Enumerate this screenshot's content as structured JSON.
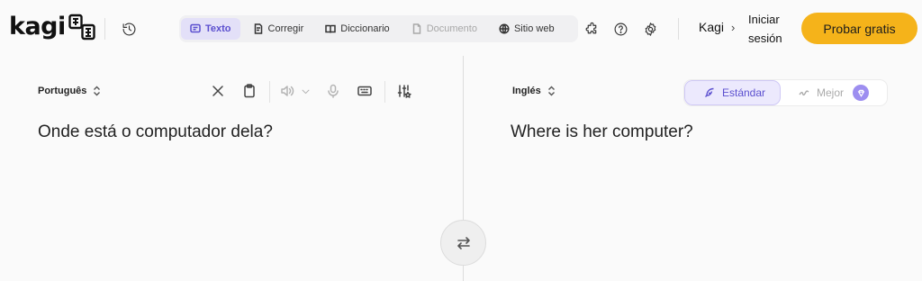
{
  "app": {
    "logo_text": "kagi",
    "logo_glyph": "translate-glyph-icon"
  },
  "header": {
    "history_icon": "history-icon",
    "tabs": [
      {
        "label": "Texto",
        "icon": "text-chat-icon",
        "active": true
      },
      {
        "label": "Corregir",
        "icon": "proofread-icon",
        "active": false
      },
      {
        "label": "Diccionario",
        "icon": "book-icon",
        "active": false
      },
      {
        "label": "Documento",
        "icon": "document-icon",
        "active": false,
        "disabled": true
      },
      {
        "label": "Sitio web",
        "icon": "globe-icon",
        "active": false
      }
    ],
    "extension_icon": "puzzle-icon",
    "help_icon": "help-icon",
    "settings_icon": "gear-icon",
    "kagi_link": "Kagi",
    "signin_label": "Iniciar sesión",
    "trial_label": "Probar gratis",
    "accent_color": "#f5b31a"
  },
  "source": {
    "language": "Português",
    "text": "Onde está o computador dela?",
    "tools": [
      "close-icon",
      "clipboard-icon",
      "speaker-icon",
      "chevron-down-icon",
      "microphone-icon",
      "keyboard-icon",
      "sliders-icon"
    ]
  },
  "target": {
    "language": "Inglés",
    "text": "Where is her computer?",
    "quality": {
      "standard_label": "Estándar",
      "better_label": "Mejor",
      "selected": "Estándar"
    }
  },
  "swap_icon": "swap-arrows-icon",
  "colors": {
    "active_tab": "#5b4fcf",
    "active_tab_bg": "#e3e0f8"
  }
}
